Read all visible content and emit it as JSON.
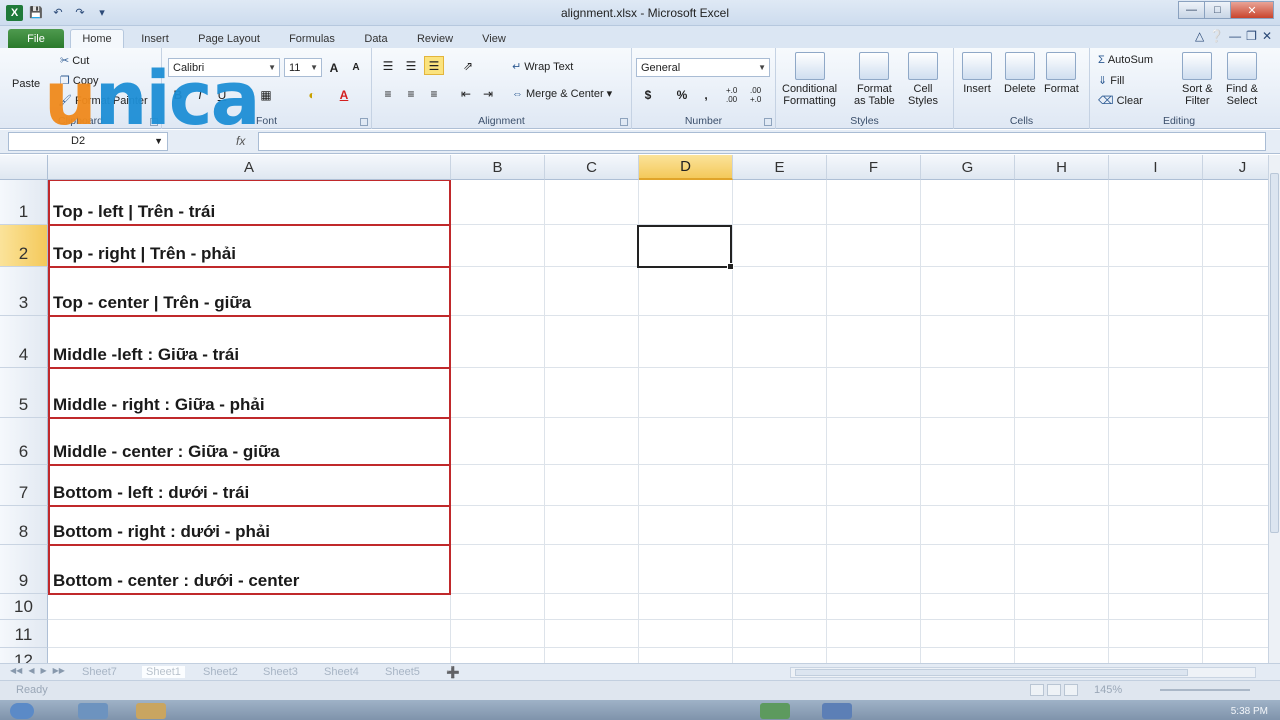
{
  "window": {
    "title": "alignment.xlsx - Microsoft Excel"
  },
  "tabs": [
    "File",
    "Home",
    "Insert",
    "Page Layout",
    "Formulas",
    "Data",
    "Review",
    "View"
  ],
  "watermark": "unica",
  "clipboard": {
    "paste": "Paste",
    "cut": "Cut",
    "copy": "Copy",
    "format_painter": "Format Painter",
    "label": "Clipboard"
  },
  "font": {
    "name": "Calibri",
    "size": "11",
    "bold": "B",
    "italic": "I",
    "underline": "U",
    "grow": "A",
    "shrink": "A",
    "font_color": "A",
    "label": "Font"
  },
  "alignment": {
    "wrap_text": "Wrap Text",
    "merge_center": "Merge & Center",
    "label": "Alignment"
  },
  "number": {
    "format": "General",
    "currency": "$",
    "percent": "%",
    "comma": ",",
    "inc_dec": "+.0 .00",
    "dec_dec": ".00 +.0",
    "label": "Number"
  },
  "styles": {
    "conditional": [
      "Conditional",
      "Formatting"
    ],
    "format_table": [
      "Format",
      "as Table"
    ],
    "cell_styles": [
      "Cell",
      "Styles"
    ],
    "label": "Styles"
  },
  "cells": {
    "insert": "Insert",
    "delete": "Delete",
    "format": "Format",
    "label": "Cells"
  },
  "editing": {
    "autosum": "AutoSum",
    "fill": "Fill",
    "clear": "Clear",
    "sort": [
      "Sort &",
      "Filter"
    ],
    "find": [
      "Find &",
      "Select"
    ],
    "label": "Editing"
  },
  "formula_bar": {
    "name_box": "D2",
    "fx": "fx",
    "value": ""
  },
  "columns": [
    "A",
    "B",
    "C",
    "D",
    "E",
    "F",
    "G",
    "H",
    "I",
    "J"
  ],
  "selected_column": "D",
  "selected_row": "2",
  "rows": [
    {
      "num": "1",
      "a": "Top - left | Trên - trái"
    },
    {
      "num": "2",
      "a": "Top - right | Trên - phải"
    },
    {
      "num": "3",
      "a": "Top - center | Trên - giữa"
    },
    {
      "num": "4",
      "a": "Middle -left : Giữa - trái"
    },
    {
      "num": "5",
      "a": "Middle - right : Giữa - phải"
    },
    {
      "num": "6",
      "a": "Middle - center : Giữa - giữa"
    },
    {
      "num": "7",
      "a": "Bottom - left : dưới - trái"
    },
    {
      "num": "8",
      "a": "Bottom - right : dưới - phải"
    },
    {
      "num": "9",
      "a": "Bottom - center : dưới - center"
    },
    {
      "num": "10",
      "a": ""
    },
    {
      "num": "11",
      "a": ""
    },
    {
      "num": "12",
      "a": ""
    }
  ],
  "sheets": [
    "Sheet7",
    "Sheet1",
    "Sheet2",
    "Sheet3",
    "Sheet4",
    "Sheet5"
  ],
  "active_sheet": "Sheet1",
  "status": {
    "ready": "Ready",
    "zoom": "145%"
  },
  "taskbar": {
    "clock": "5:38 PM"
  }
}
